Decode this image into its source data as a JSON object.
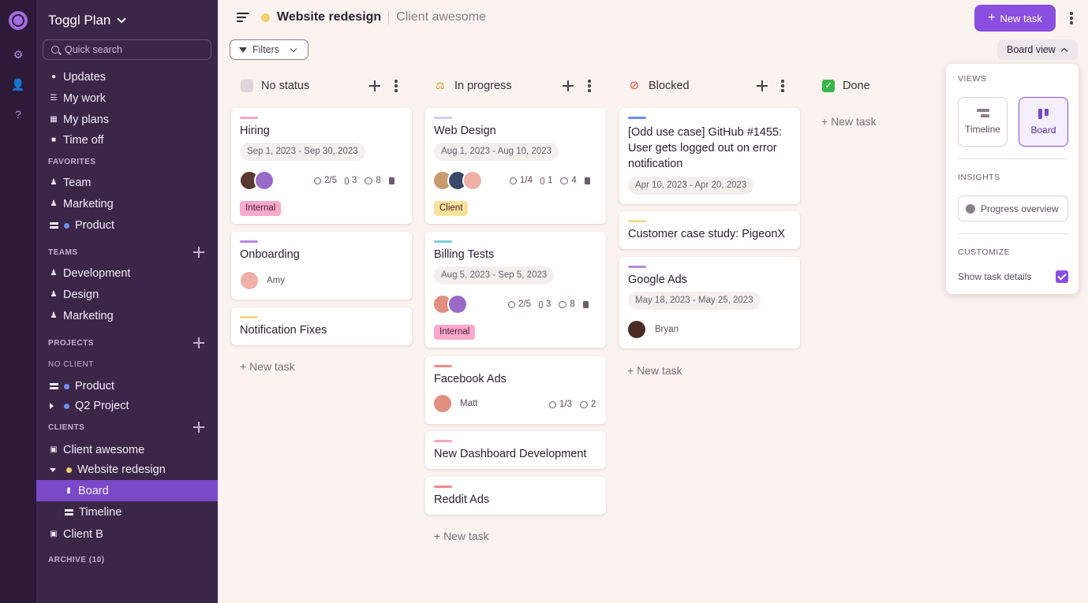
{
  "app": {
    "workspace_name": "Toggl Plan"
  },
  "search": {
    "placeholder": "Quick search"
  },
  "sidebar": {
    "main_items": [
      {
        "label": "Updates",
        "icon": "bell-icon"
      },
      {
        "label": "My work",
        "icon": "list-icon"
      },
      {
        "label": "My plans",
        "icon": "plans-icon"
      },
      {
        "label": "Time off",
        "icon": "suitcase-icon"
      }
    ],
    "favorites_label": "FAVORITES",
    "favorites": [
      {
        "label": "Team",
        "icon": "people-icon"
      },
      {
        "label": "Marketing",
        "icon": "people-icon"
      },
      {
        "label": "Product",
        "icon": "timeline-icon",
        "dot_color": "#6c8ef0"
      }
    ],
    "teams_label": "TEAMS",
    "teams": [
      {
        "label": "Development"
      },
      {
        "label": "Design"
      },
      {
        "label": "Marketing"
      }
    ],
    "projects_label": "PROJECTS",
    "no_client_label": "NO CLIENT",
    "no_client_projects": [
      {
        "label": "Product",
        "dot_color": "#6c8ef0"
      },
      {
        "label": "Q2 Project",
        "dot_color": "#6c8ef0"
      }
    ],
    "clients_label": "CLIENTS",
    "clients": [
      {
        "label": "Client awesome"
      },
      {
        "label": "Website redesign",
        "dot_color": "#f2d06b"
      },
      {
        "label": "Board"
      },
      {
        "label": "Timeline"
      },
      {
        "label": "Client B"
      }
    ],
    "archive_label": "ARCHIVE (10)"
  },
  "header": {
    "project_title": "Website redesign",
    "project_dot_color": "#f2d06b",
    "client_name": "Client awesome",
    "new_task_label": "New task",
    "filters_label": "Filters",
    "view_label": "Board view"
  },
  "columns": [
    {
      "name": "No status",
      "icon": "no-status-icon",
      "cards": [
        {
          "title": "Hiring",
          "stripe": "#f3a5c9",
          "date": "Sep 1, 2023 - Sep 30, 2023",
          "checklist": "2/5",
          "attachments": "3",
          "comments": "8",
          "tag": "Internal",
          "tag_color": "#f8a9cc"
        },
        {
          "title": "Onboarding",
          "stripe": "#b48ae6",
          "assignee": "Amy"
        },
        {
          "title": "Notification Fixes",
          "stripe": "#f5d98a"
        }
      ],
      "new_task": "+ New task"
    },
    {
      "name": "In progress",
      "icon": "construction-icon",
      "cards": [
        {
          "title": "Web Design",
          "stripe": "#c9d1f2",
          "date": "Aug 1, 2023 - Aug 10, 2023",
          "checklist": "1/4",
          "attachments": "1",
          "comments": "4",
          "tag": "Client",
          "tag_color": "#f8e19a"
        },
        {
          "title": "Billing Tests",
          "stripe": "#7dcfd8",
          "date": "Aug 5, 2023 - Sep 5, 2023",
          "checklist": "2/5",
          "attachments": "3",
          "comments": "8",
          "tag": "Internal",
          "tag_color": "#f8a9cc"
        },
        {
          "title": "Facebook Ads",
          "stripe": "#f08a8a",
          "assignee": "Matt",
          "checklist": "1/3",
          "comments": "2"
        },
        {
          "title": "New Dashboard Development",
          "stripe": "#f3a5c9"
        },
        {
          "title": "Reddit Ads",
          "stripe": "#f08a8a"
        }
      ],
      "new_task": "+ New task"
    },
    {
      "name": "Blocked",
      "icon": "blocked-icon",
      "cards": [
        {
          "title_lines": [
            "[Odd use case] GitHub #1455:",
            "User gets logged out on error",
            "notification"
          ],
          "stripe": "#6c8ef0",
          "date": "Apr 10, 2023 - Apr 20, 2023"
        },
        {
          "title": "Customer case study: PigeonX",
          "stripe": "#f5d98a"
        },
        {
          "title": "Google Ads",
          "stripe": "#b48ae6",
          "date": "May 18, 2023 - May 25, 2023",
          "assignee": "Bryan"
        }
      ],
      "new_task": "+ New task"
    },
    {
      "name": "Done",
      "icon": "done-check-icon",
      "cards": [],
      "new_task": "+ New task"
    }
  ],
  "views_menu": {
    "views_label": "VIEWS",
    "timeline_label": "Timeline",
    "board_label": "Board",
    "insights_label": "INSIGHTS",
    "progress_label": "Progress overview",
    "customize_label": "CUSTOMIZE",
    "show_details_label": "Show task details",
    "show_details_checked": true
  }
}
